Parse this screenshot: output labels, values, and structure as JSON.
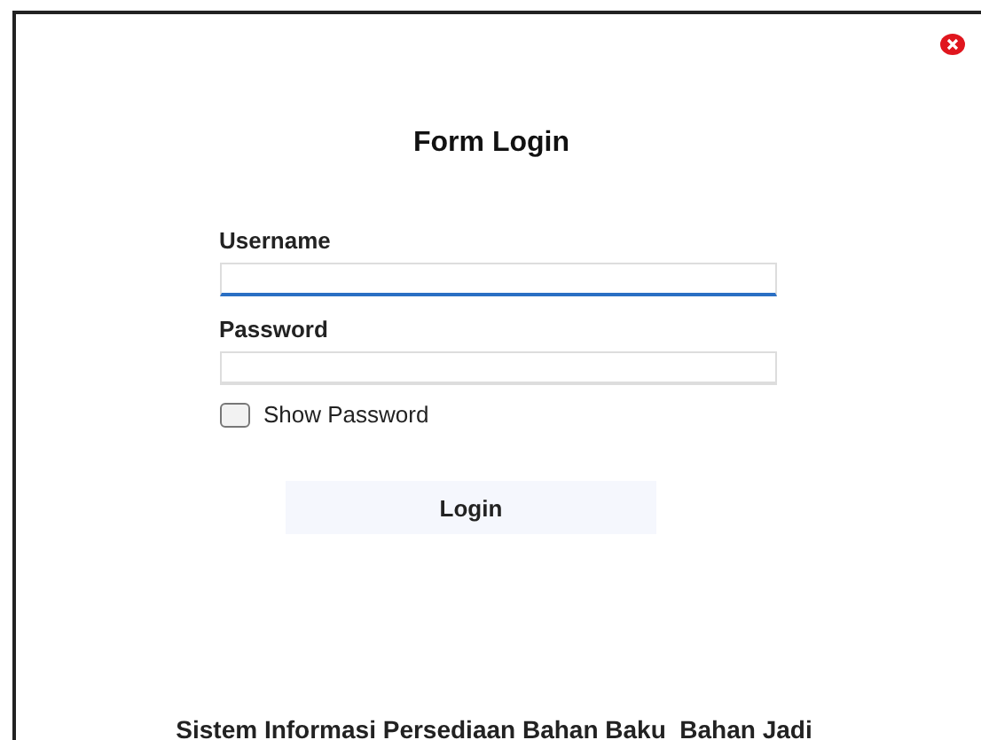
{
  "title": "Form Login",
  "fields": [
    {
      "label": "Username",
      "focused": true
    },
    {
      "label": "Password",
      "focused": false
    }
  ],
  "show_password": {
    "label": "Show Password",
    "checked": false
  },
  "button": "Login",
  "footer": "Sistem Informasi Persediaan Bahan Baku  Bahan Jadi"
}
